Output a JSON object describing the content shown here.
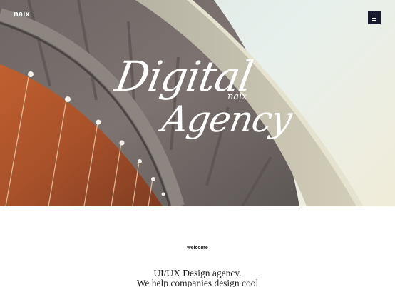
{
  "header": {
    "brand": "naix",
    "menu_icon": "hamburger-icon"
  },
  "hero": {
    "title_line1": "Digital",
    "title_line2": "Agency",
    "subtitle": "naix"
  },
  "intro": {
    "eyebrow": "welcome",
    "lines": [
      "UI/UX Design agency.",
      "We help companies design cool"
    ]
  },
  "colors": {
    "menu_button": "#181c2e",
    "hero_text": "#ffffff",
    "copper": "#b65a2c"
  }
}
